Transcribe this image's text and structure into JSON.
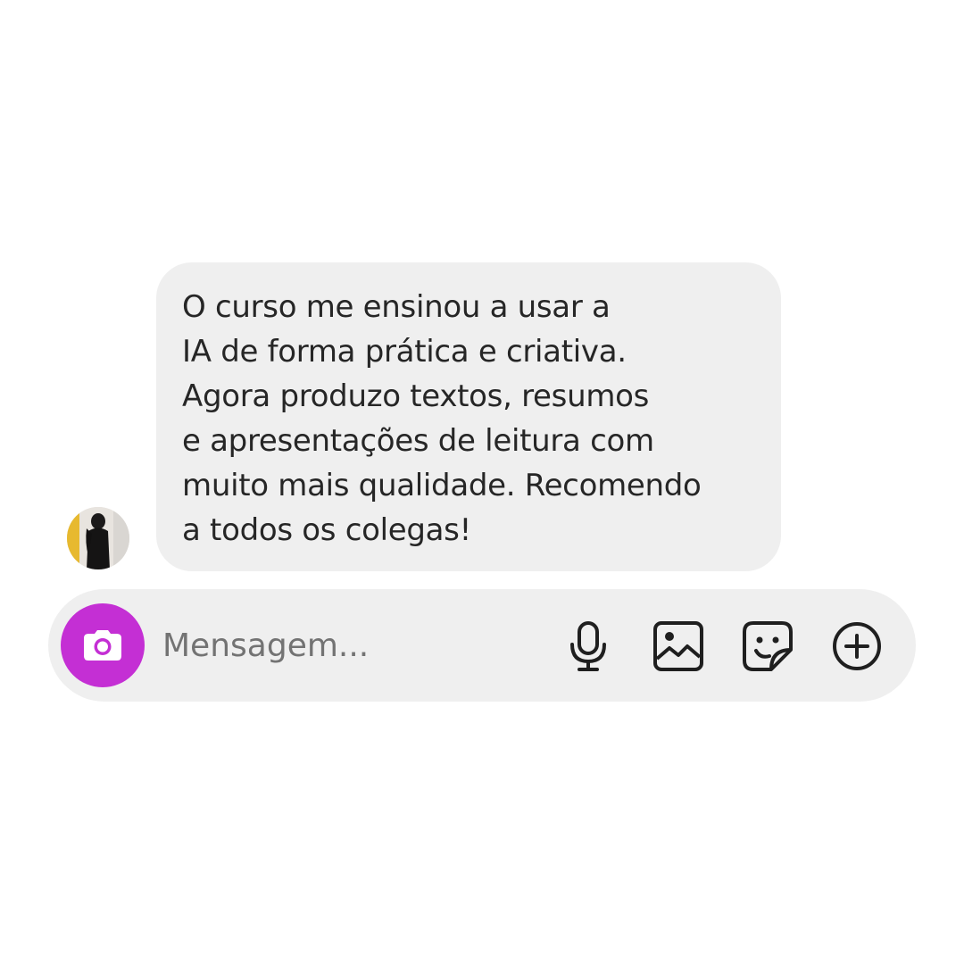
{
  "message": {
    "text": "O curso me ensinou a usar a\nIA de forma prática e criativa.\nAgora produzo textos, resumos\ne apresentações de leitura com\nmuito mais qualidade. Recomendo\na todos os colegas!",
    "bubble_color": "#efefef"
  },
  "composer": {
    "placeholder": "Mensagem...",
    "camera_color": "#c42fd4",
    "icons": [
      "microphone-icon",
      "gallery-icon",
      "sticker-icon",
      "add-icon"
    ]
  }
}
